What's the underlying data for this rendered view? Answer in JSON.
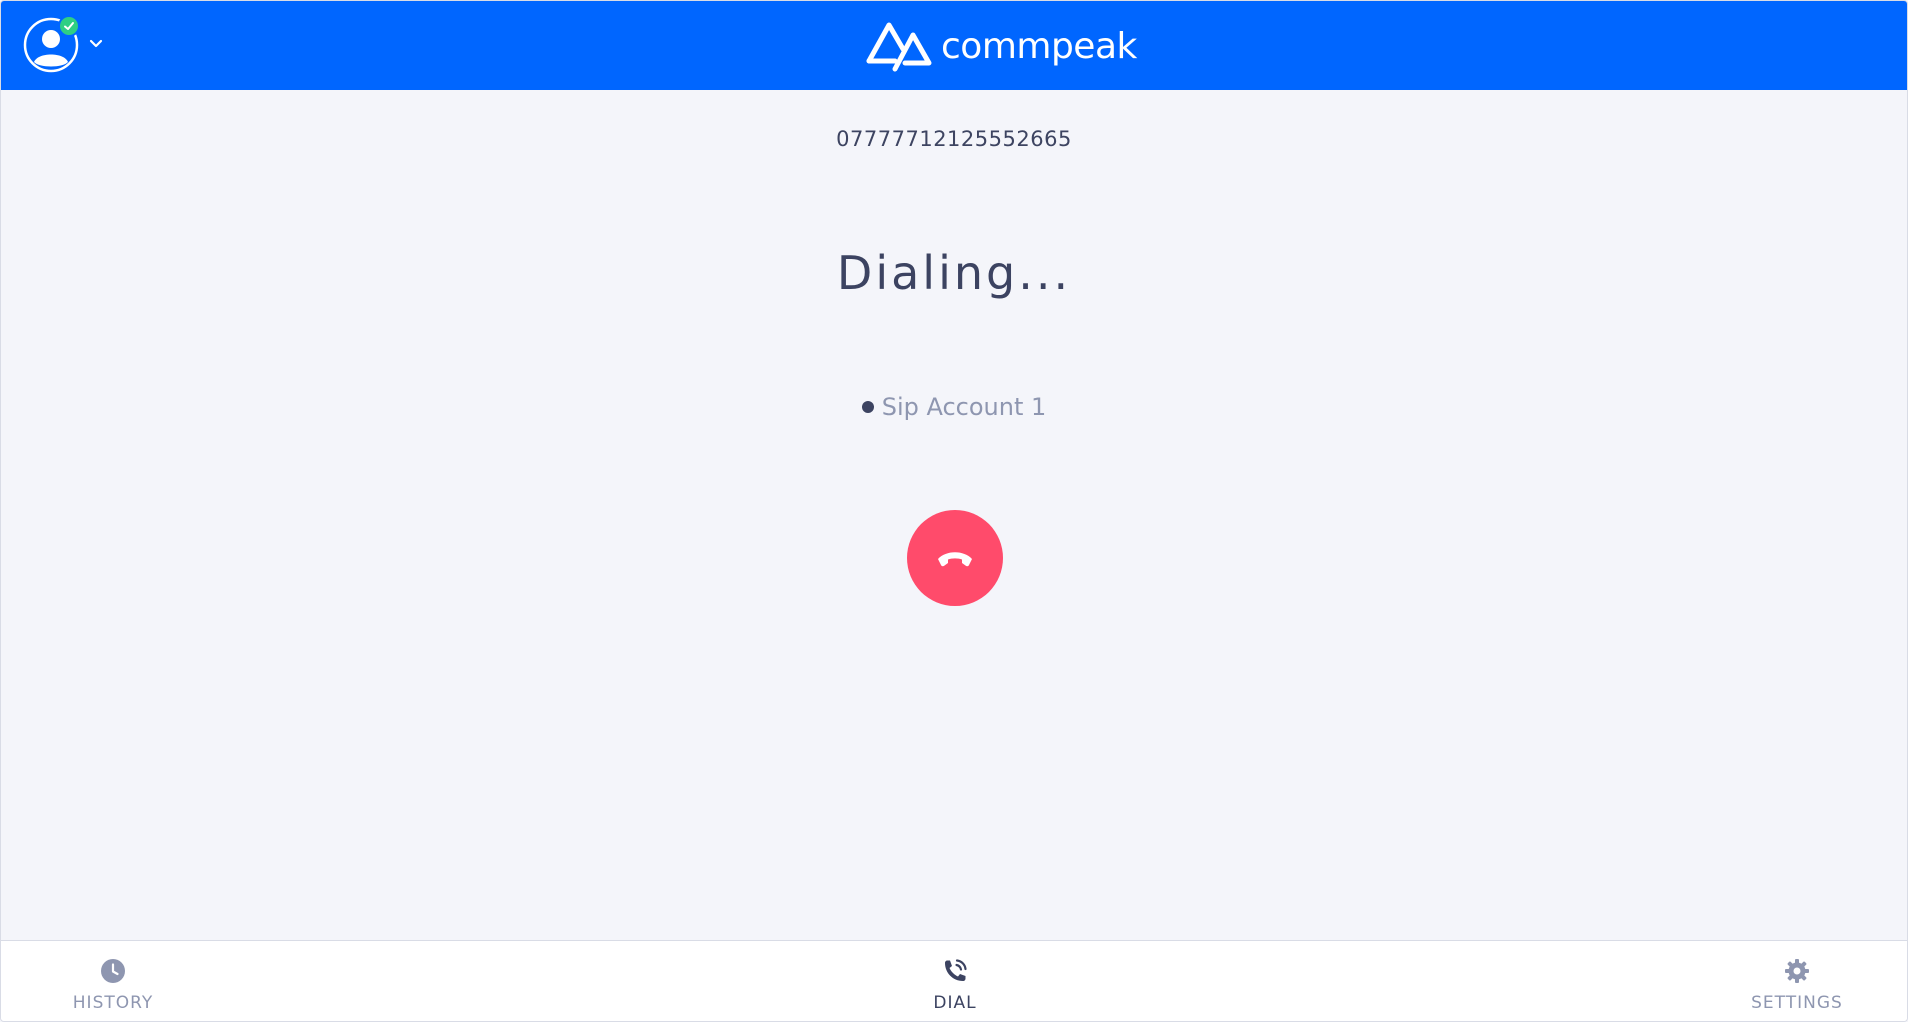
{
  "header": {
    "brand": "commpeak",
    "avatar_status": "online"
  },
  "call": {
    "number": "07777712125552665",
    "status": "Dialing...",
    "account": "Sip Account 1"
  },
  "nav": {
    "history_label": "HISTORY",
    "dial_label": "DIAL",
    "settings_label": "SETTINGS",
    "active": "dial"
  },
  "colors": {
    "header_bg": "#0066ff",
    "hangup": "#ff4b6b",
    "status_online": "#2fcf84",
    "text_dark": "#3c4361",
    "text_muted": "#8e96b0"
  },
  "icons": {
    "avatar": "user-circle-icon",
    "status": "check-icon",
    "menu": "chevron-down-icon",
    "logo": "commpeak-logo-icon",
    "hangup": "phone-hangup-icon",
    "history": "clock-icon",
    "dial": "phone-calling-icon",
    "settings": "gear-icon"
  }
}
